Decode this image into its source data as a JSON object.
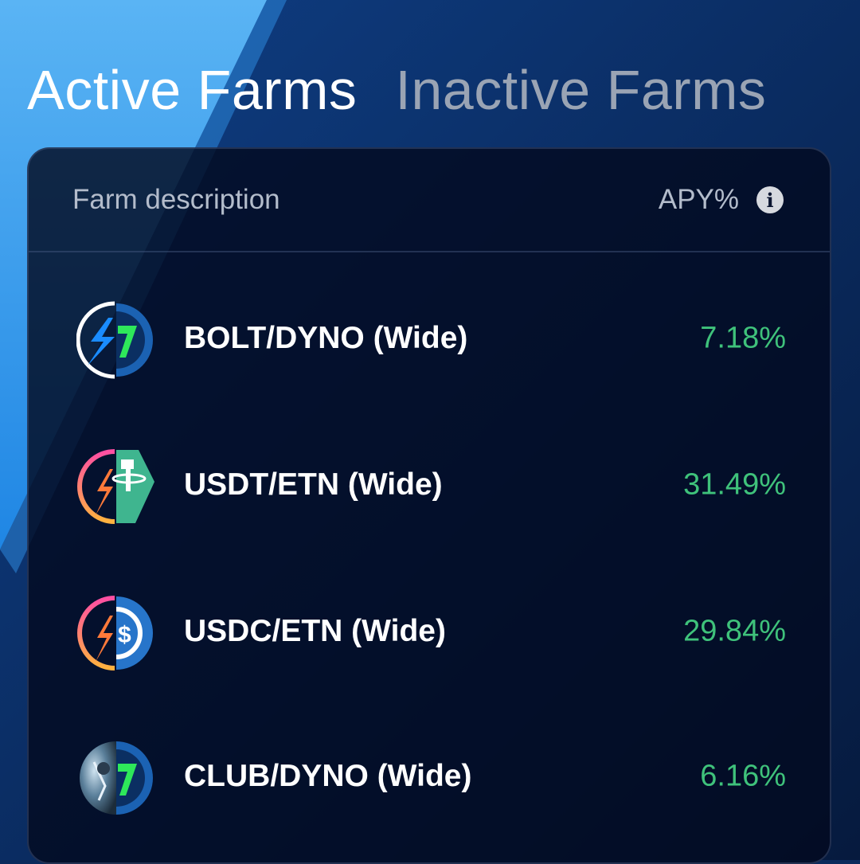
{
  "tabs": {
    "active": "Active Farms",
    "inactive": "Inactive Farms"
  },
  "table": {
    "description_header": "Farm description",
    "apy_header": "APY%",
    "rows": [
      {
        "name": "BOLT/DYNO (Wide)",
        "apy": "7.18%",
        "left_icon": "bolt-token-icon",
        "right_icon": "dyno-token-icon"
      },
      {
        "name": "USDT/ETN (Wide)",
        "apy": "31.49%",
        "left_icon": "etn-token-icon",
        "right_icon": "usdt-token-icon"
      },
      {
        "name": "USDC/ETN (Wide)",
        "apy": "29.84%",
        "left_icon": "etn-token-icon",
        "right_icon": "usdc-token-icon"
      },
      {
        "name": "CLUB/DYNO (Wide)",
        "apy": "6.16%",
        "left_icon": "club-token-icon",
        "right_icon": "dyno-token-icon"
      }
    ]
  },
  "colors": {
    "apy_positive": "#3fc27b",
    "background_dark": "#0a2a5c",
    "background_light": "#3aa0f0"
  }
}
